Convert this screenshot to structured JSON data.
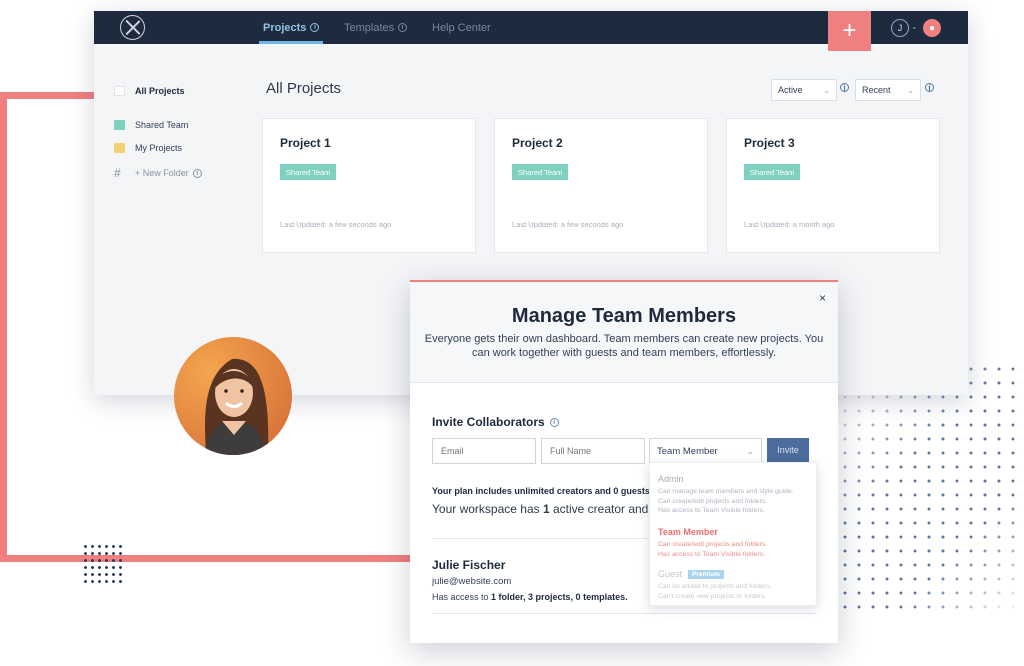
{
  "colors": {
    "accent": "#f07f7f",
    "navbar": "#1e2a3e",
    "teal": "#7fd2c0",
    "yellow": "#f4cf74",
    "button": "#4c6c9b"
  },
  "topbar": {
    "nav": [
      {
        "label": "Projects",
        "active": true
      },
      {
        "label": "Templates",
        "active": false
      },
      {
        "label": "Help Center",
        "active": false
      }
    ],
    "plus_label": "+",
    "avatar_initial": "J"
  },
  "sidebar": {
    "all_projects": "All Projects",
    "items": [
      {
        "label": "Shared Team",
        "color": "#7fd2c0"
      },
      {
        "label": "My Projects",
        "color": "#f4cf74"
      }
    ],
    "new_folder": "+ New Folder",
    "hash": "#"
  },
  "main": {
    "title": "All Projects",
    "filter_status": "Active",
    "filter_sort": "Recent",
    "cards": [
      {
        "title": "Project 1",
        "tag": "Shared Team",
        "updated": "Last Updated: a few seconds ago"
      },
      {
        "title": "Project 2",
        "tag": "Shared Team",
        "updated": "Last Updated: a few seconds ago"
      },
      {
        "title": "Project 3",
        "tag": "Shared Team",
        "updated": "Last Updated: a month ago"
      }
    ]
  },
  "modal": {
    "close": "×",
    "title": "Manage Team Members",
    "description": "Everyone gets their own dashboard. Team members can create new projects. You can work together with guests and team members, effortlessly.",
    "invite_title": "Invite Collaborators",
    "email_placeholder": "Email",
    "name_placeholder": "Full Name",
    "role_selected": "Team Member",
    "invite_button": "Invite",
    "plan_text": "Your plan includes unlimited creators and 0 guests.",
    "workspace_prefix": "Your workspace has ",
    "workspace_count": "1",
    "workspace_suffix": " active creator and 0 guests.",
    "member": {
      "name": "Julie Fischer",
      "email": "julie@website.com",
      "access_prefix": "Has access to ",
      "access_bold": "1 folder, 3 projects, 0 templates."
    }
  },
  "role_dropdown": {
    "options": [
      {
        "title": "Admin",
        "desc": [
          "Can manage team members and style guide.",
          "Can create/edit projects and folders.",
          "Has access to Team Visible folders."
        ]
      },
      {
        "title": "Team Member",
        "desc": [
          "Can create/edit projects and folders.",
          "Has access to Team Visible folders."
        ]
      },
      {
        "title": "Guest",
        "badge": "Premium",
        "desc": [
          "Can be added to projects and folders.",
          "Can't create new projects or folders."
        ]
      }
    ]
  }
}
